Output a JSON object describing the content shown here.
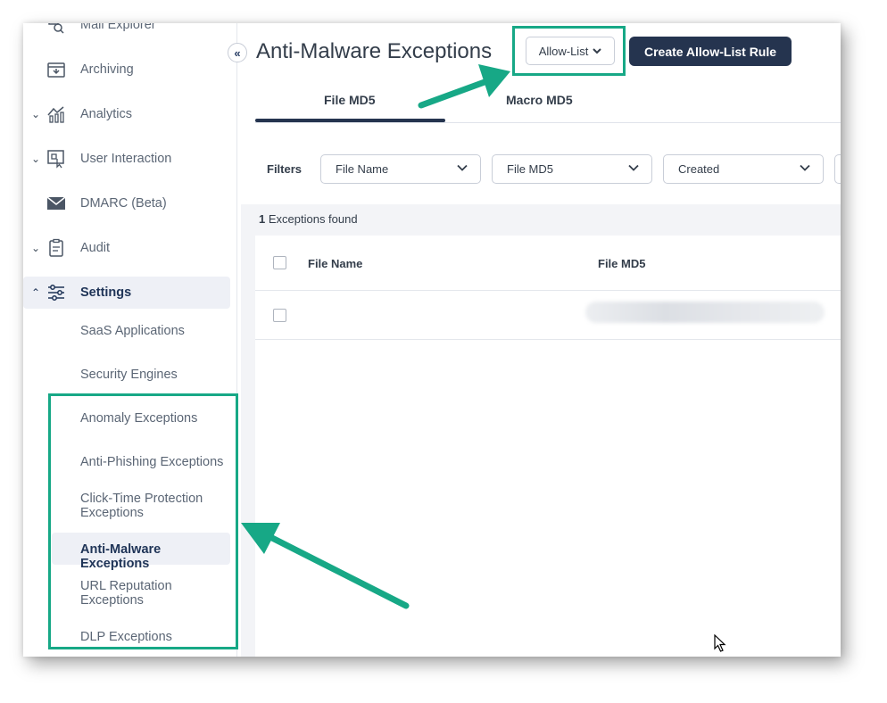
{
  "sidebar": {
    "collapse_icon": "double-chevron-left",
    "items": [
      {
        "label": "Mail Explorer",
        "icon": "mail-search-icon",
        "expandable": false
      },
      {
        "label": "Archiving",
        "icon": "archive-icon",
        "expandable": false
      },
      {
        "label": "Analytics",
        "icon": "analytics-icon",
        "expandable": true
      },
      {
        "label": "User Interaction",
        "icon": "user-interaction-icon",
        "expandable": true
      },
      {
        "label": "DMARC (Beta)",
        "icon": "envelope-icon",
        "expandable": false
      },
      {
        "label": "Audit",
        "icon": "clipboard-icon",
        "expandable": true
      },
      {
        "label": "Settings",
        "icon": "sliders-icon",
        "expandable": true,
        "expanded": true
      }
    ],
    "settings_children": [
      {
        "label": "SaaS Applications"
      },
      {
        "label": "Security Engines"
      },
      {
        "label": "Anomaly Exceptions"
      },
      {
        "label": "Anti-Phishing Exceptions"
      },
      {
        "label": "Click-Time Protection Exceptions"
      },
      {
        "label": "Anti-Malware Exceptions",
        "active": true
      },
      {
        "label": "URL Reputation Exceptions"
      },
      {
        "label": "DLP Exceptions"
      }
    ]
  },
  "header": {
    "title": "Anti-Malware Exceptions",
    "list_dropdown": "Allow-List",
    "create_button": "Create Allow-List Rule"
  },
  "tabs": [
    {
      "label": "File MD5",
      "active": true
    },
    {
      "label": "Macro MD5",
      "active": false
    }
  ],
  "filters": {
    "label": "Filters",
    "selects": [
      "File Name",
      "File MD5",
      "Created"
    ]
  },
  "results": {
    "count": "1",
    "suffix": "Exceptions found"
  },
  "table": {
    "columns": [
      "File Name",
      "File MD5"
    ],
    "rows": [
      {
        "file_name": "",
        "file_md5": "",
        "md5_redacted": true
      }
    ]
  },
  "colors": {
    "accent_highlight": "#17a886",
    "primary_dark": "#25344f",
    "active_bg": "#eef0f6"
  }
}
